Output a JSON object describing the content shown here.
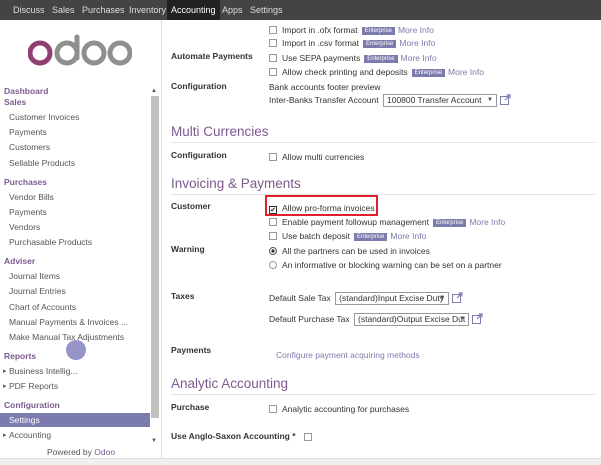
{
  "topbar": {
    "items": [
      "Discuss",
      "Sales",
      "Purchases",
      "Inventory",
      "Accounting",
      "Apps",
      "Settings"
    ],
    "active": "Accounting"
  },
  "sidebar": {
    "logo_text": "odoo",
    "dashboard": "Dashboard",
    "sales": {
      "title": "Sales",
      "items": [
        "Customer Invoices",
        "Payments",
        "Customers",
        "Sellable Products"
      ]
    },
    "purchases": {
      "title": "Purchases",
      "items": [
        "Vendor Bills",
        "Payments",
        "Vendors",
        "Purchasable Products"
      ]
    },
    "adviser": {
      "title": "Adviser",
      "items": [
        "Journal Items",
        "Journal Entries",
        "Chart of Accounts",
        "Manual Payments & Invoices ...",
        "Make Manual Tax Adjustments"
      ]
    },
    "reports": {
      "title": "Reports",
      "items": [
        "Business Intellig...",
        "PDF Reports"
      ]
    },
    "configuration": {
      "title": "Configuration",
      "items": [
        "Settings",
        "Accounting"
      ]
    },
    "powered_by": "Powered by",
    "powered_brand": "Odoo"
  },
  "main": {
    "import_ofx": "Import in .ofx format",
    "import_csv": "Import in .csv format",
    "automate_payments_label": "Automate Payments",
    "use_sepa": "Use SEPA payments",
    "allow_check": "Allow check printing and deposits",
    "configuration_label": "Configuration",
    "bank_footer": "Bank accounts footer preview",
    "interbanks_label": "Inter-Banks Transfer Account",
    "interbanks_value": "100800 Transfer Account",
    "multi_currencies_title": "Multi Currencies",
    "multi_config_label": "Configuration",
    "allow_multi": "Allow multi currencies",
    "invoicing_title": "Invoicing & Payments",
    "customer_label": "Customer",
    "allow_proforma": "Allow pro-forma invoices",
    "enable_followup": "Enable payment followup management",
    "use_batch": "Use batch deposit",
    "warning_label": "Warning",
    "warning_opt1": "All the partners can be used in invoices",
    "warning_opt2": "An informative or blocking warning can be set on a partner",
    "taxes_label": "Taxes",
    "default_sale_tax_label": "Default Sale Tax",
    "default_sale_tax_value": "(standard)Input Excise Duty",
    "default_purchase_tax_label": "Default Purchase Tax",
    "default_purchase_tax_value": "(standard)Output Excise Dut",
    "payments_label": "Payments",
    "configure_payment_link": "Configure payment acquiring methods",
    "analytic_title": "Analytic Accounting",
    "purchase_label": "Purchase",
    "analytic_purchases": "Analytic accounting for purchases",
    "anglo_saxon_label": "Use Anglo-Saxon Accounting *",
    "enterprise_badge": "Enterprise",
    "more_info": "More Info"
  },
  "colors": {
    "brand": "#7c5a8f",
    "accent": "#7c7bad",
    "highlight": "#e0202a",
    "topbar": "#444444"
  }
}
